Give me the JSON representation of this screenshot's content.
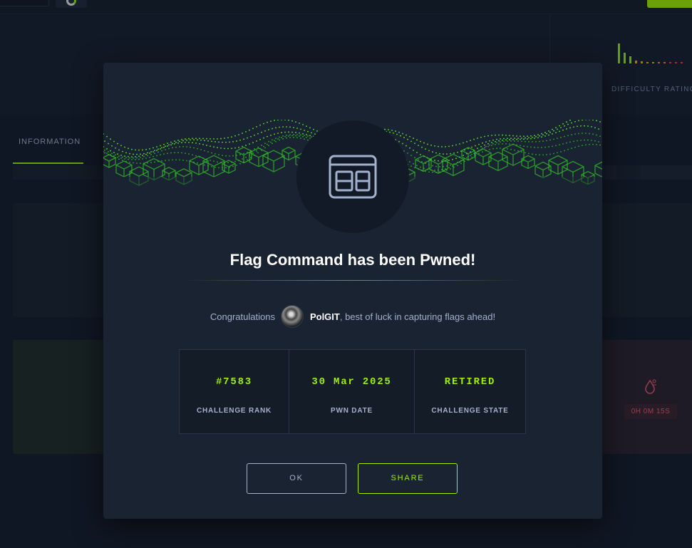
{
  "background": {
    "difficulty_label": "DIFFICULTY RATING",
    "tab_information": "INFORMATION",
    "first_blood_time": "0H 0M 15S"
  },
  "modal": {
    "title": "Flag Command has been Pwned!",
    "congrats_prefix": "Congratulations",
    "username": "PolGIT",
    "congrats_suffix": ", best of luck in capturing flags ahead!",
    "stats": [
      {
        "value": "#7583",
        "label": "CHALLENGE RANK"
      },
      {
        "value": "30 Mar 2025",
        "label": "PWN DATE"
      },
      {
        "value": "RETIRED",
        "label": "CHALLENGE STATE"
      }
    ],
    "ok_label": "OK",
    "share_label": "SHARE",
    "icon": "web-window-icon"
  },
  "colors": {
    "accent": "#9fef00",
    "background": "#141d2b",
    "modal": "#1a2332",
    "danger": "#e8576a"
  }
}
